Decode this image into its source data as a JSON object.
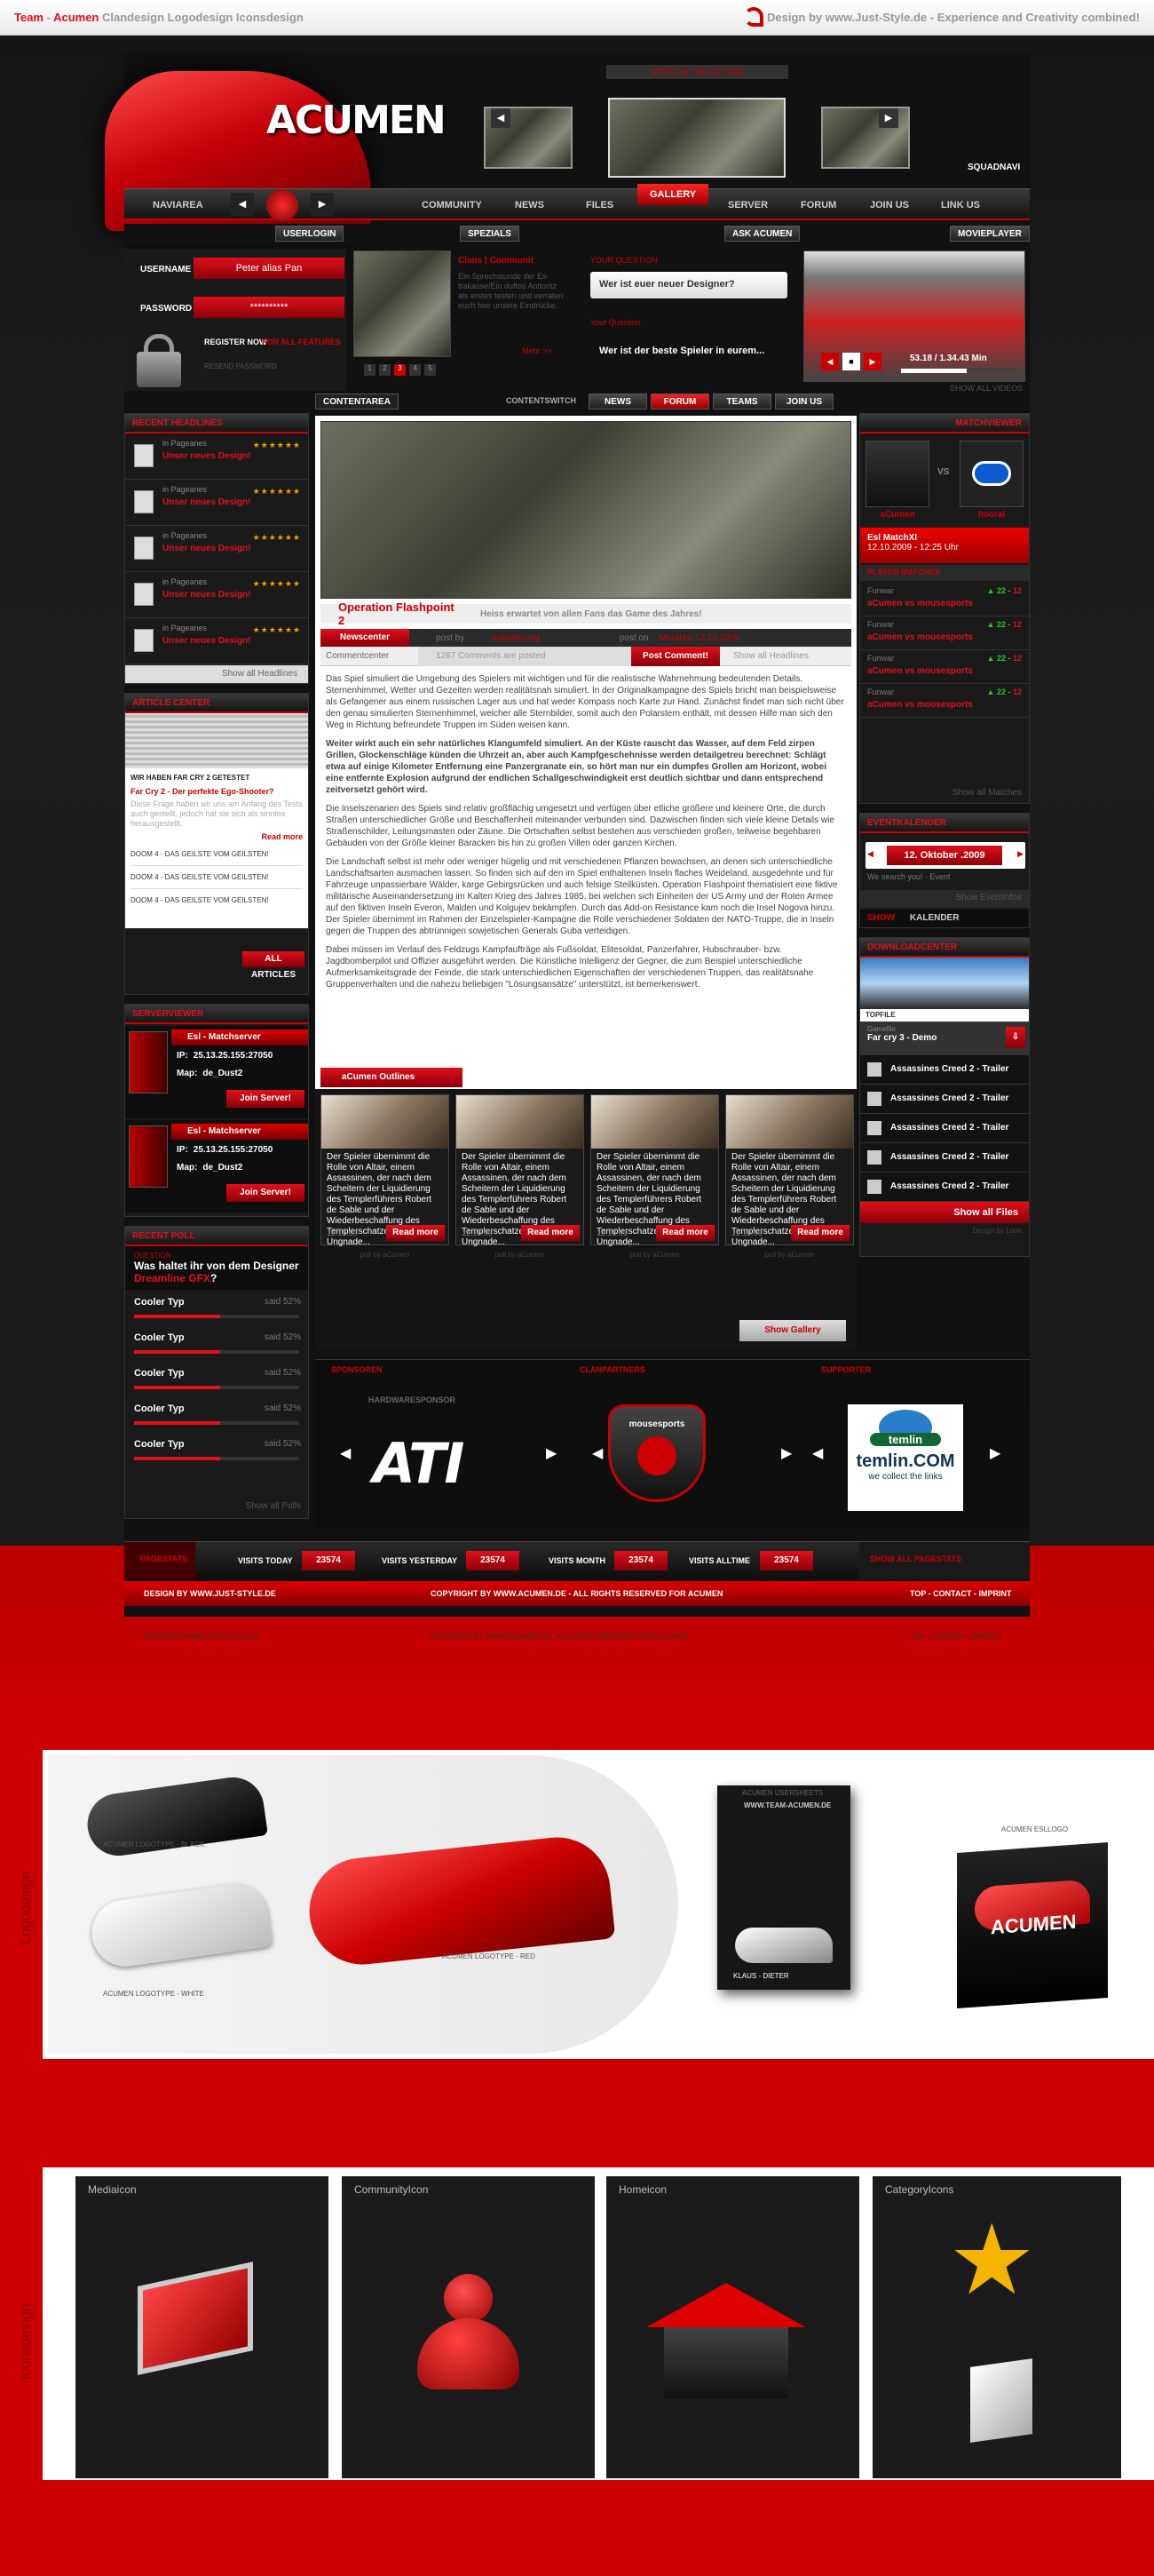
{
  "header": {
    "left_team": "Team",
    "left_dash": " - ",
    "left_acumen": "Acumen",
    "left_rest": " Clandesign  Logodesign  Iconsdesign",
    "right": "Design by www.Just-Style.de - Experience and Creativity combined!"
  },
  "logo": {
    "text": "ACUMEN"
  },
  "nav": {
    "navi_label": "NAVIAREA",
    "items": [
      "COMMUNITY",
      "NEWS",
      "FILES",
      "GALLERY",
      "SERVER",
      "FORUM",
      "JOIN US",
      "LINK US"
    ],
    "squadnavi": "SQUADNAVI",
    "gallery_title": "ARTIST IN THE PICTURE"
  },
  "subnav": {
    "userlogin": "USERLOGIN",
    "spezials": "SPEZIALS",
    "ask": "ASK ACUMEN",
    "movieplayer": "MOVIEPLAYER"
  },
  "login": {
    "username_label": "USERNAME",
    "username_value": "Peter alias Pan",
    "password_label": "PASSWORD",
    "password_value": "**********",
    "register": "REGISTER NOW",
    "features": "FOR ALL FEATURES",
    "forgot": "RESEND PASSWORD"
  },
  "special": {
    "title": "Clans | Communit",
    "text": "Ein Sprechstunde der Ex-trakasse/Ein duftos Antloritz als erstes testen und verraten euch hier unsere Eindrücke.",
    "more": "Mehr >>",
    "pages": [
      "1",
      "2",
      "3",
      "4",
      "5"
    ]
  },
  "ask": {
    "title": "YOUR QUESTION",
    "q1": "Wer ist euer neuer Designer?",
    "title2": "Your Question",
    "q2": "Wer ist der beste Spieler in eurem..."
  },
  "movie": {
    "time": "53.18 / 1.34.43 Min",
    "all": "SHOW ALL VIDEOS"
  },
  "content_tabs": {
    "contentarea": "CONTENTAREA",
    "contentswitch": "CONTENTSWITCH",
    "tabs": [
      "NEWS",
      "FORUM",
      "TEAMS",
      "JOIN US"
    ]
  },
  "left_headlines": {
    "title": "RECENT HEADLINES",
    "items": [
      {
        "cat": "in Pageanes",
        "title": "Unser neues Design!"
      },
      {
        "cat": "in Pageanes",
        "title": "Unser neues Design!"
      },
      {
        "cat": "in Pageanes",
        "title": "Unser neues Design!"
      },
      {
        "cat": "in Pageanes",
        "title": "Unser neues Design!"
      },
      {
        "cat": "in Pageanes",
        "title": "Unser neues Design!"
      }
    ],
    "all": "Show all Headlines"
  },
  "article_spot": {
    "title": "ARTICLE CENTER",
    "head": "WIR HABEN FAR CRY 2 GETESTET",
    "sub": "Far Cry 2 - Der perfekte Ego-Shooter?",
    "text": "Diese Frage haben wir uns am Anfang des Tests auch gestellt, jedoch hat sie sich als sinnlos herausgestellt.",
    "more": "Read more",
    "items": [
      "DOOM 4 - DAS GEILSTE VOM GEILSTEN!",
      "DOOM 4 - DAS GEILSTE VOM GEILSTEN!",
      "DOOM 4 - DAS GEILSTE VOM GEILSTEN!"
    ],
    "all": "ALL ARTICLES"
  },
  "servers": {
    "title": "SERVERVIEWER",
    "items": [
      {
        "name": "Esl - Matchserver",
        "ip_label": "IP:",
        "ip": "25.13.25.155:27050",
        "map_label": "Map:",
        "map": "de_Dust2",
        "join": "Join Server!"
      },
      {
        "name": "Esl - Matchserver",
        "ip_label": "IP:",
        "ip": "25.13.25.155:27050",
        "map_label": "Map:",
        "map": "de_Dust2",
        "join": "Join Server!"
      }
    ]
  },
  "poll": {
    "title": "RECENT POLL",
    "label": "QUESTION",
    "q": "Was haltet ihr von dem Designer",
    "q_red": "Dreamline GFX",
    "q_end": "?",
    "options": [
      {
        "t": "Cooler Typ",
        "p": "said 52%",
        "v": 52
      },
      {
        "t": "Cooler Typ",
        "p": "said 52%",
        "v": 52
      },
      {
        "t": "Cooler Typ",
        "p": "said 52%",
        "v": 52
      },
      {
        "t": "Cooler Typ",
        "p": "said 52%",
        "v": 52
      },
      {
        "t": "Cooler Typ",
        "p": "said 52%",
        "v": 52
      }
    ],
    "all": "Show all Polls"
  },
  "news": {
    "title": "Operation Flashpoint 2",
    "subtitle": "Heiss erwartet von allen Fans das Game des Jahres!",
    "newscenter": "Newscenter",
    "postby": "post by",
    "author": "miliperlo.org",
    "poston": "post on",
    "date": "Monday, 12.10.2009",
    "commentcenter": "Commentcenter",
    "comments": "1287 Comments are posted",
    "post_btn": "Post Comment!",
    "show_all": "Show all Headlines",
    "p1": "Das Spiel simuliert die Umgebung des Spielers mit wichtigen und für die realistische Wahrnehmung bedeutenden Details. Sternenhimmel, Wetter und Gezeiten werden realitätsnah simuliert. In der Originalkampagne des Spiels bricht man beispielsweise als Gefangener aus einem russischen Lager aus und hat weder Kompass noch Karte zur Hand. Zunächst findet man sich nicht über den genau simulierten Sternenhimmel, welcher alle Sternbilder, somit auch den Polarstern enthält, mit dessen Hilfe man sich den Weg in Richtung befreundete Truppen im Süden weisen kann.",
    "p2": "Weiter wirkt auch ein sehr natürliches Klangumfeld simuliert. An der Küste rauscht das Wasser, auf dem Feld zirpen Grillen, Glockenschläge künden die Uhrzeit an, aber auch Kampfgeschehnisse werden detailgetreu berechnet: Schlägt etwa auf einige Kilometer Entfernung eine Panzergranate ein, so hört man nur ein dumpfes Grollen am Horizont, wobei eine entfernte Explosion aufgrund der endlichen Schallgeschwindigkeit erst deutlich sichtbar und dann entsprechend zeitversetzt gehört wird.",
    "p3": "Die Inselszenarien des Spiels sind relativ großflächig umgesetzt und verfügen über etliche größere und kleinere Orte, die durch Straßen unterschiedlicher Größe und Beschaffenheit miteinander verbunden sind. Dazwischen finden sich viele kleine Details wie Straßenschilder, Leitungsmasten oder Zäune. Die Ortschaften selbst bestehen aus verschieden großen, teilweise begehbaren Gebäuden von der Größe kleiner Baracken bis hin zu großen Villen oder ganzen Kirchen.",
    "p4": "Die Landschaft selbst ist mehr oder weniger hügelig und mit verschiedenen Pflanzen bewachsen, an denen sich unterschiedliche Landschaftsarten ausmachen lassen. So finden sich auf den im Spiel enthaltenen Inseln flaches Weideland, ausgedehnte und für Fahrzeuge unpassierbare Wälder, karge Gebirgsrücken und auch felsige Steilküsten. Operation Flashpoint thematisiert eine fiktive militärische Auseinandersetzung im Kalten Krieg des Jahres 1985, bei welchen sich Einheiten der US Army und der Roten Armee auf den fiktiven Inseln Everon, Malden und Kolgujev bekämpfen. Durch das Add-on Resistance kam noch die Insel Nogova hinzu. Der Spieler übernimmt im Rahmen der Einzelspieler-Kampagne die Rolle verschiedener Soldaten der NATO-Truppe, die in Inseln gegen die Truppen des abtrünnigen sowjetischen Generals Guba verteidigen.",
    "p5": "Dabei müssen im Verlauf des Feldzugs Kampfaufträge als Fußsoldat, Elitesoldat, Panzerfahrer, Hubschrauber- bzw. Jagdbomberpilot und Offizier ausgeführt werden. Die Künstliche Intelligenz der Gegner, die zum Beispiel unterschiedliche Aufmerksamkeitsgrade der Feinde, die stark unterschiedlichen Eigenschaften der verschiedenen Truppen, das realitätsnahe Gruppenverhalten und die nahezu beliebigen \"Lösungsansätze\" unterstützt, ist bemerkenswert."
  },
  "outlines": {
    "tab_red": "aCumen",
    "tab_white": "Outlines",
    "tile_text": "Der Spieler übernimmt die Rolle von Altair, einem Assassinen, der nach dem Scheitern der Liquidierung des Templerführers Robert de Sable und der Wiederbeschaffung des Templerschatzes, in Ungnade...",
    "date": "12.10.09",
    "more": "Read more",
    "sub": "poll by aCumen",
    "show": "Show Gallery"
  },
  "match": {
    "title": "MATCHVIEWER",
    "team1": "aCumen",
    "vs": "VS",
    "team2": "hoorai",
    "league": "Esl MatchXI",
    "time": "12.10.2009 - 12:25 Uhr",
    "played": "PLAYED MATCHES",
    "rows": [
      {
        "g": "Funwar",
        "s1": "22",
        "s2": "12",
        "m": "aCumen vs mousesports"
      },
      {
        "g": "Funwar",
        "s1": "22",
        "s2": "12",
        "m": "aCumen vs mousesports"
      },
      {
        "g": "Funwar",
        "s1": "22",
        "s2": "12",
        "m": "aCumen vs mousesports"
      },
      {
        "g": "Funwar",
        "s1": "22",
        "s2": "12",
        "m": "aCumen vs mousesports"
      }
    ],
    "all": "Show all Matches"
  },
  "events": {
    "title": "EVENTKALENDER",
    "date": "12. Oktober .2009",
    "note": "We search you! - Event",
    "all": "Show Eventinfos",
    "show": "SHOW",
    "kalender": "KALENDER"
  },
  "downloads": {
    "title": "DOWNLOADCENTER",
    "topfile_label": "TOPFILE",
    "topfile_sub": "Gamefile",
    "topfile": "Far cry 3 - Demo",
    "items": [
      "Assassines Creed 2 - Trailer",
      "Assassines Creed 2 - Trailer",
      "Assassines Creed 2 - Trailer",
      "Assassines Creed 2 - Trailer",
      "Assassines Creed 2 - Trailer"
    ],
    "all": "Show all Files",
    "sub": "Design by Lorie"
  },
  "sponsors": {
    "s1": "SPONSOREN",
    "s2": "CLANPARTNERS",
    "s3": "SUPPORTER",
    "hardware": "HARDWARESPONSOR",
    "ati": "ATI",
    "mouse": "mousesports",
    "temlin": "temlin",
    "temlin2": "temlin.COM",
    "temlin3": "we collect the links"
  },
  "stats": {
    "label": "PAGESTATS",
    "today_l": "VISITS TODAY",
    "today": "23574",
    "yest_l": "VISITS YESTERDAY",
    "yest": "23574",
    "month_l": "VISITS MONTH",
    "month": "23574",
    "all_l": "VISITS ALLTIME",
    "all": "23574",
    "show": "SHOW ALL PAGESTATS"
  },
  "footer": {
    "left": "DESIGN BY WWW.JUST-STYLE.DE",
    "mid": "COPYRIGHT BY WWW.ACUMEN.DE - ALL RIGHTS RESERVED FOR ACUMEN",
    "right": "TOP - CONTACT - IMPRINT",
    "faint_l": "DESIGN BY WWW.JUST-STYLE.DE",
    "faint_m": "COPYRIGHT BY WWW.ACUMEN.DE - ALL RIGHTS RESERVED FOR ACUMEN",
    "faint_r": "TOP - CONTACT - IMPRINT"
  },
  "logos": {
    "side": "Logodesign",
    "black": "ACUMEN LOGOTYPE - BLACK",
    "white": "ACUMEN LOGOTYPE - WHITE",
    "red": "ACUMEN LOGOTYPE - RED",
    "usersheet": "ACUMEN USERSHEETS",
    "usersheet_url": "WWW.TEAM-ACUMEN.DE",
    "usersheet_name": "KLAUS - DIETER",
    "esl": "ACUMEN ESLLOGO",
    "esl_text": "ACUMEN"
  },
  "icons": {
    "side": "Iconsdesign",
    "media": "Mediaicon",
    "community": "CommunityIcon",
    "home": "Homeicon",
    "category": "CategoryIcons"
  }
}
